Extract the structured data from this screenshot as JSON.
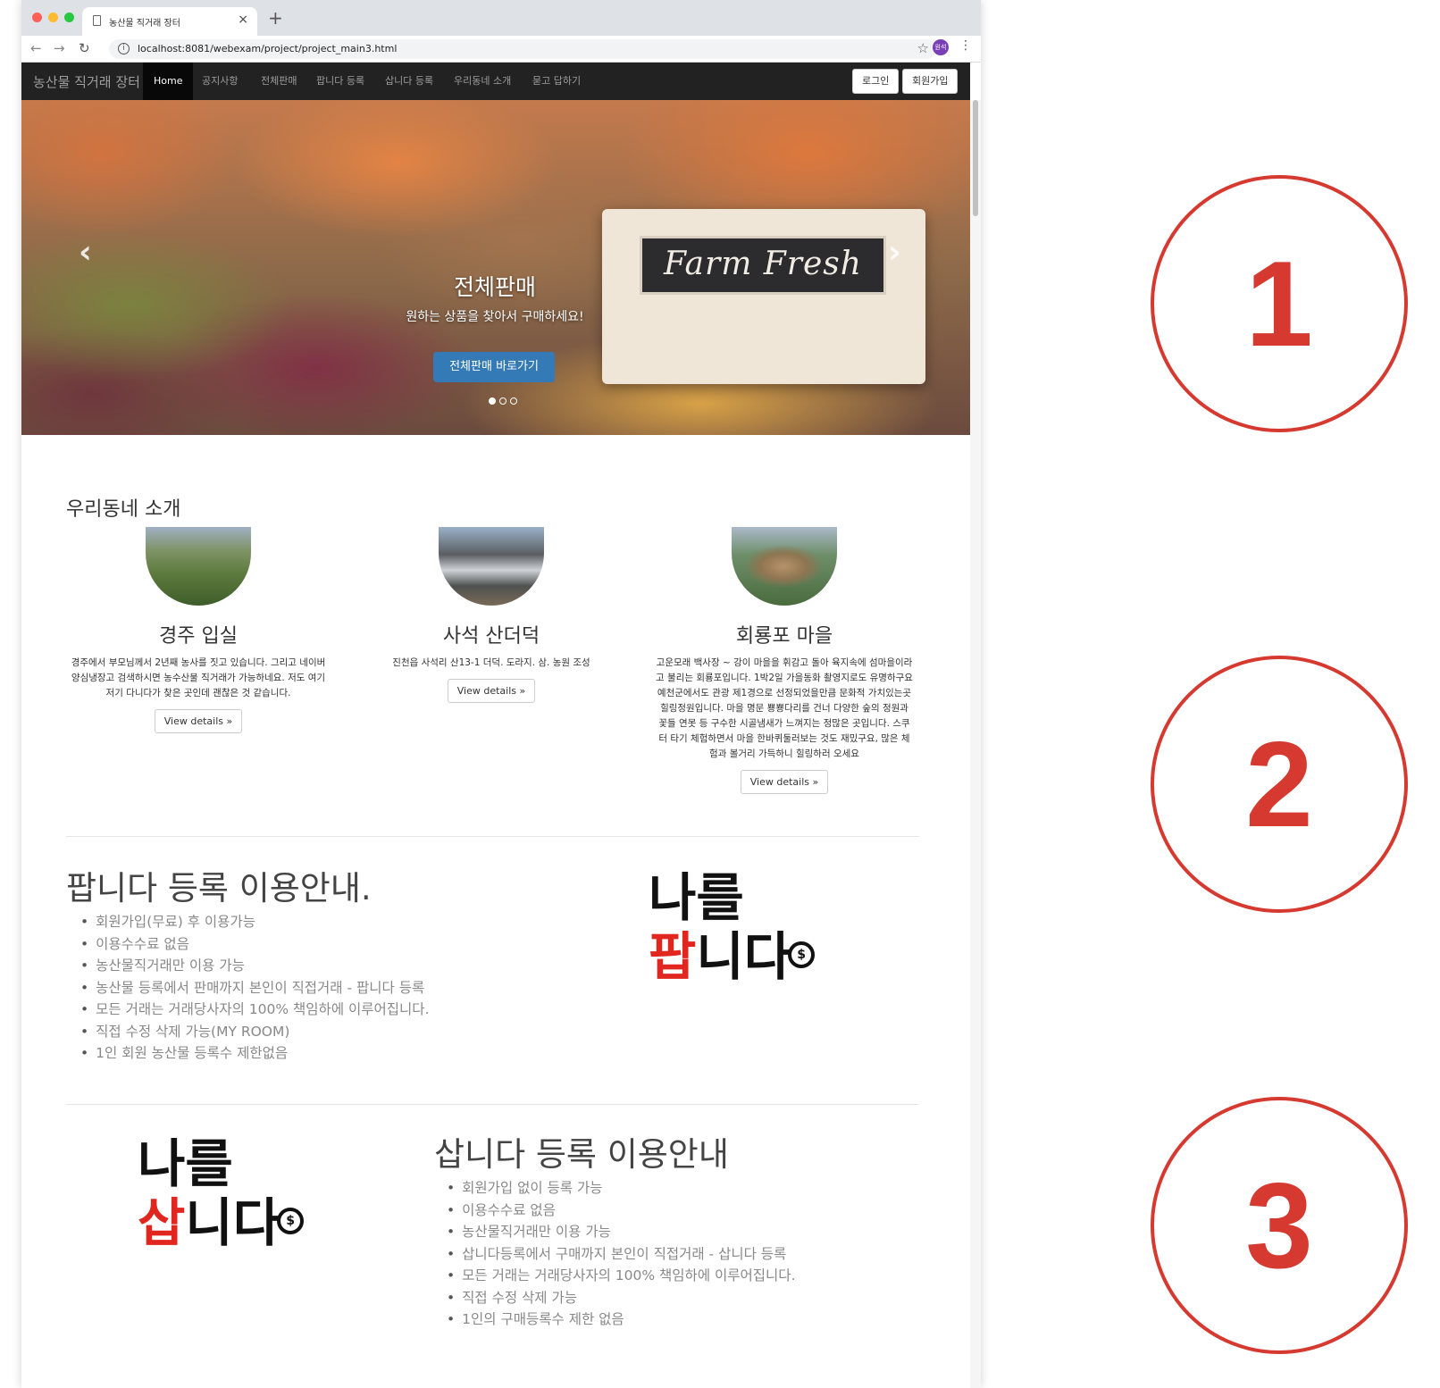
{
  "browser": {
    "tab_title": "농산물 직거래 장터",
    "url": "localhost:8081/webexam/project/project_main3.html",
    "profile_label": "원석"
  },
  "navbar": {
    "brand": "농산물 직거래 장터",
    "items": [
      "Home",
      "공지사항",
      "전체판매",
      "팝니다 등록",
      "삽니다 등록",
      "우리동네 소개",
      "묻고 답하기"
    ],
    "active": "Home",
    "login": "로그인",
    "signup": "회원가입"
  },
  "hero": {
    "title": "전체판매",
    "subtitle": "원하는 상품을 찾아서 구매하세요!",
    "button": "전체판매 바로가기",
    "sign_text": "Farm Fresh",
    "slides_total": 3,
    "active_slide": 1
  },
  "intro": {
    "heading": "우리동네 소개",
    "features": [
      {
        "title": "경주 입실",
        "description": "경주에서 부모님께서 2년째 농사를 짓고 있습니다. 그리고 네이버 양심냉장고 검색하시면 농수산물 직거래가 가능하네요. 저도 여기저기 다니다가 찾은 곳인데 괜찮은 것 같습니다.",
        "button": "View details »"
      },
      {
        "title": "사석 산더덕",
        "description": "진천읍 사석리 산13-1 더덕. 도라지. 삼. 농원 조성",
        "button": "View details »"
      },
      {
        "title": "회룡포 마을",
        "description": "고운모래 백사장 ~ 강이 마을을 휘감고 돌아 육지속에 섬마을이라고 불리는 회룡포입니다. 1박2일 가을동화 촬영지로도 유명하구요 예천군에서도 관광 제1경으로 선정되었을만큼 문화적 가치있는곳 힐링정원입니다. 마을 명문 뿅뿅다리를 건너 다양한 숲의 정원과 꽃들 연못 등 구수한 시골냄새가 느껴지는 정많은 곳입니다. 스쿠터 타기 체험하면서 마을 한바퀴둘러보는 것도 재밌구요, 많은 체험과 볼거리 가득하니 힐링하러 오세요",
        "button": "View details »"
      }
    ]
  },
  "sell_section": {
    "title": "팝니다 등록 이용안내.",
    "items": [
      "회원가입(무료) 후 이용가능",
      "이용수수료 없음",
      "농산물직거래만 이용 가능",
      "농산물 등록에서 판매까지 본인이 직접거래 - 팝니다 등록",
      "모든 거래는 거래당사자의 100% 책임하에 이루어집니다.",
      "직접 수정 삭제 가능(MY ROOM)",
      "1인 회원 농산물 등록수 제한없음"
    ],
    "logo_line1": "나를",
    "logo_red": "팝",
    "logo_rest": "니다"
  },
  "buy_section": {
    "title": "삽니다 등록 이용안내",
    "items": [
      "회원가입 없이 등록 가능",
      "이용수수료 없음",
      "농산물직거래만 이용 가능",
      "삽니다등록에서 구매까지 본인이 직접거래 - 삽니다 등록",
      "모든 거래는 거래당사자의 100% 책임하에 이루어집니다.",
      "직접 수정 삭제 가능",
      "1인의 구매등록수 제한 없음"
    ],
    "logo_line1": "나를",
    "logo_red": "삽",
    "logo_rest": "니다"
  },
  "callouts": [
    "1",
    "2",
    "3"
  ],
  "colors": {
    "navbar_bg": "#222222",
    "primary_button": "#337ab7",
    "callout_red": "#d6392f",
    "logo_red": "#e0261f"
  }
}
